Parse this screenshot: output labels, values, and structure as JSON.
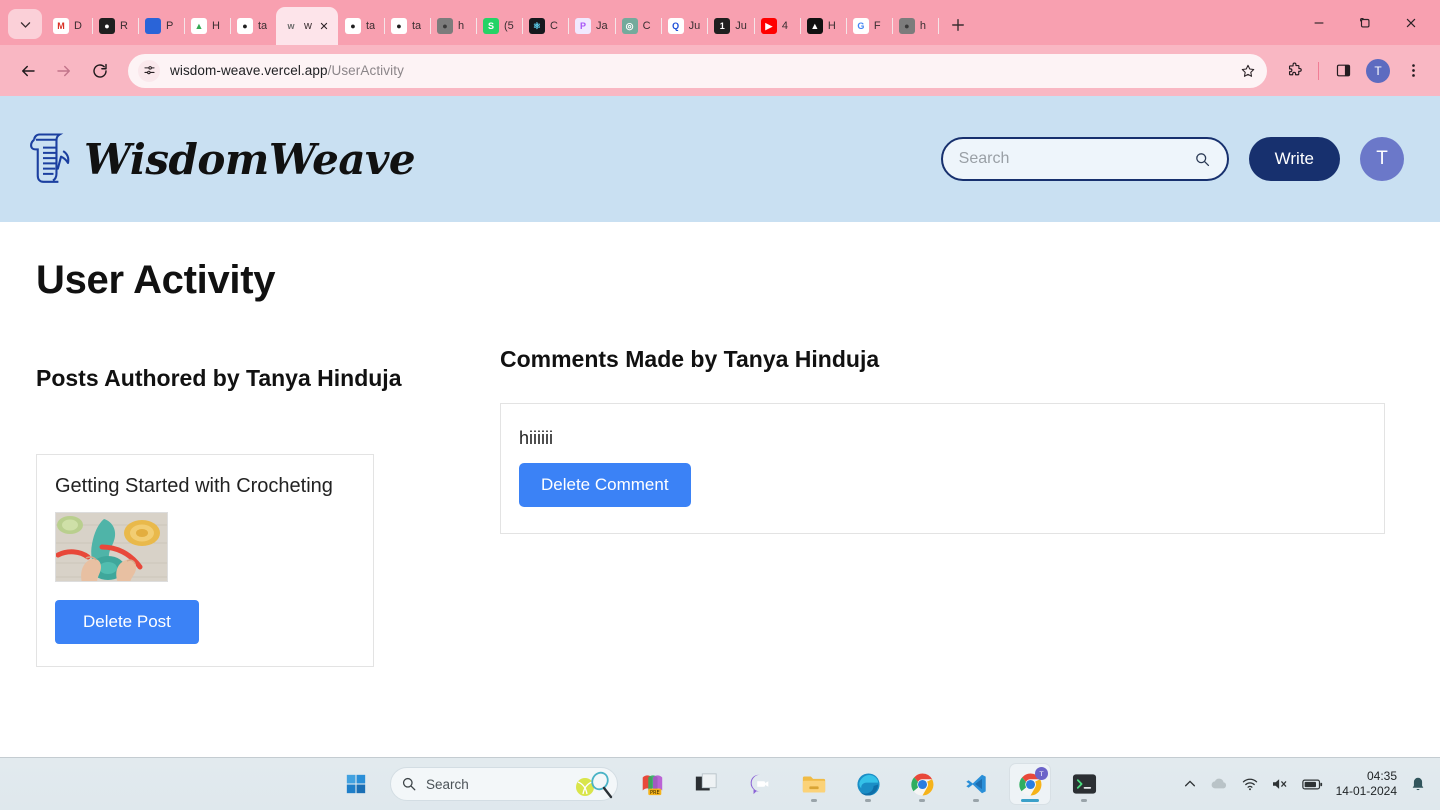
{
  "browser": {
    "tabs": [
      {
        "title": "D",
        "icon": "gmail-icon",
        "active": false
      },
      {
        "title": "R",
        "icon": "dark-icon",
        "active": false
      },
      {
        "title": "P",
        "icon": "bluedot-icon",
        "active": false
      },
      {
        "title": "H",
        "icon": "gdrive-icon",
        "active": false
      },
      {
        "title": "ta",
        "icon": "github-icon",
        "active": false
      },
      {
        "title": "w",
        "icon": "wisdomweave-icon",
        "active": true
      },
      {
        "title": "ta",
        "icon": "github-icon",
        "active": false
      },
      {
        "title": "ta",
        "icon": "github-icon",
        "active": false
      },
      {
        "title": "h",
        "icon": "globe-icon",
        "active": false
      },
      {
        "title": "(5",
        "icon": "whatsapp-icon",
        "active": false
      },
      {
        "title": "C",
        "icon": "react-icon",
        "active": false
      },
      {
        "title": "Ja",
        "icon": "perplexity-icon",
        "active": false
      },
      {
        "title": "C",
        "icon": "chatgpt-icon",
        "active": false
      },
      {
        "title": "Ju",
        "icon": "quora-icon",
        "active": false
      },
      {
        "title": "Ju",
        "icon": "doc-icon",
        "active": false
      },
      {
        "title": "4",
        "icon": "youtube-icon",
        "active": false
      },
      {
        "title": "H",
        "icon": "vercel-icon",
        "active": false
      },
      {
        "title": "F",
        "icon": "google-icon",
        "active": false
      },
      {
        "title": "h",
        "icon": "globe-icon",
        "active": false
      }
    ],
    "new_tab_label": "+",
    "url_domain": "wisdom-weave.vercel.app",
    "url_path": "/UserActivity",
    "profile_initial": "T",
    "window_controls": [
      "minimize",
      "maximize",
      "close"
    ],
    "toolbar_icons": [
      "back-icon",
      "forward-icon",
      "reload-icon",
      "site-info-icon",
      "bookmark-star-icon",
      "extensions-icon",
      "side-panel-icon",
      "chrome-menu-icon"
    ]
  },
  "site": {
    "logo_text": "WisdomWeave",
    "search_placeholder": "Search",
    "search_value": "",
    "write_label": "Write",
    "avatar_initial": "T"
  },
  "main": {
    "page_title": "User Activity",
    "posts_heading": "Posts Authored by Tanya Hinduja",
    "comments_heading": "Comments Made by Tanya Hinduja",
    "posts": [
      {
        "title": "Getting Started with Crocheting",
        "image_alt": "crocheting-hands-photo",
        "delete_label": "Delete Post"
      }
    ],
    "comments": [
      {
        "text": "hiiiiii",
        "delete_label": "Delete Comment"
      }
    ]
  },
  "colors": {
    "chrome_tabstrip": "#f8a0b0",
    "chrome_toolbar": "#f9b7c3",
    "site_header": "#c9e0f2",
    "brand_navy": "#17306e",
    "button_blue": "#3b82f6",
    "avatar_purple": "#6b78c9"
  },
  "taskbar": {
    "start_label": "start-button",
    "search_placeholder": "Search",
    "apps": [
      "teams-icon",
      "file-explorer-icon",
      "edge-icon",
      "chrome-icon",
      "vscode-icon",
      "chrome-active-icon",
      "terminal-icon"
    ],
    "tray": [
      "chevron-up-icon",
      "onedrive-icon",
      "wifi-icon",
      "volume-muted-icon",
      "battery-icon"
    ],
    "time": "04:35",
    "date": "14-01-2024",
    "notification_icon": "bell-icon"
  }
}
